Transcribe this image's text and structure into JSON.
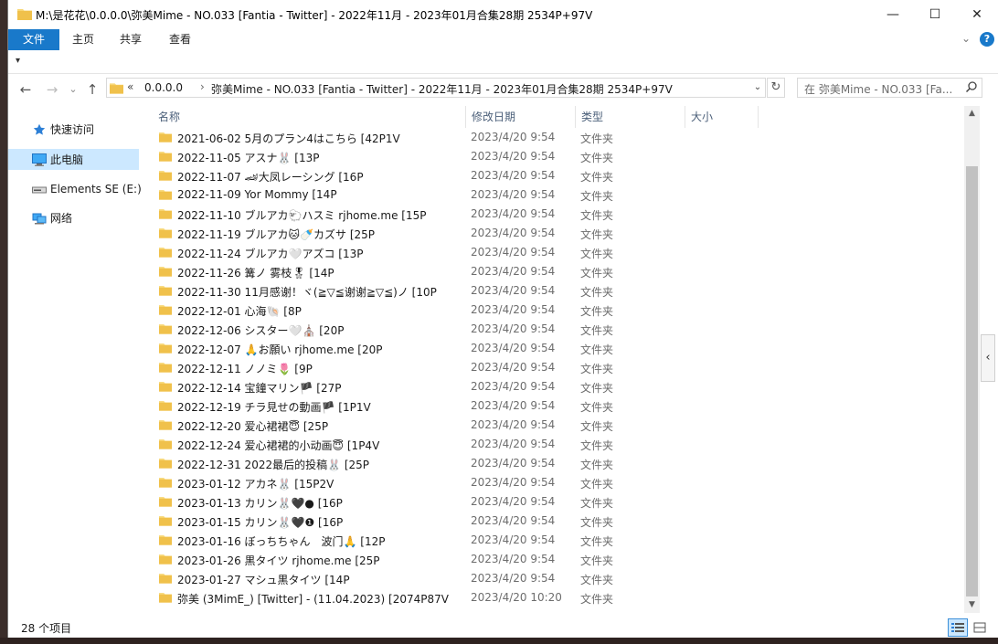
{
  "window": {
    "title": "M:\\是花花\\0.0.0.0\\弥美Mime - NO.033 [Fantia - Twitter] - 2022年11月 - 2023年01月合集28期 2534P+97V",
    "min_glyph": "—",
    "max_glyph": "☐",
    "close_glyph": "✕"
  },
  "ribbon": {
    "tabs": [
      "文件",
      "主页",
      "共享",
      "查看"
    ],
    "active_tab": 0,
    "expand_glyph": "⌄",
    "help_glyph": "?"
  },
  "nav": {
    "back": "←",
    "forward": "→",
    "recent": "⌄",
    "up": "↑",
    "refresh": "↻",
    "chevron": "«",
    "breadcrumb": [
      "0.0.0.0",
      "弥美Mime - NO.033 [Fantia - Twitter] - 2022年11月 - 2023年01月合集28期 2534P+97V"
    ],
    "separator": "›",
    "dropdown": "⌄",
    "search_placeholder": "在 弥美Mime - NO.033 [Fa..."
  },
  "navpane": {
    "items": [
      {
        "label": "快速访问",
        "icon": "star-icon"
      },
      {
        "label": "此电脑",
        "icon": "computer-icon",
        "selected": true
      },
      {
        "label": "Elements SE (E:)",
        "icon": "drive-icon"
      },
      {
        "label": "网络",
        "icon": "network-icon"
      }
    ]
  },
  "columns": [
    "名称",
    "修改日期",
    "类型",
    "大小"
  ],
  "sort_glyph": "^",
  "files": [
    {
      "name": "2021-06-02 5月のプラン4はこちら [42P1V",
      "date": "2023/4/20 9:54",
      "type": "文件夹"
    },
    {
      "name": "2022-11-05 アスナ🐰 [13P",
      "date": "2023/4/20 9:54",
      "type": "文件夹"
    },
    {
      "name": "2022-11-07 🏎大凤レーシング [16P",
      "date": "2023/4/20 9:54",
      "type": "文件夹"
    },
    {
      "name": "2022-11-09 Yor Mommy [14P",
      "date": "2023/4/20 9:54",
      "type": "文件夹"
    },
    {
      "name": "2022-11-10 ブルアカ🐑ハスミ rjhome.me [15P",
      "date": "2023/4/20 9:54",
      "type": "文件夹"
    },
    {
      "name": "2022-11-19 ブルアカ🐱🍼カズサ [25P",
      "date": "2023/4/20 9:54",
      "type": "文件夹"
    },
    {
      "name": "2022-11-24 ブルアカ🤍アズコ [13P",
      "date": "2023/4/20 9:54",
      "type": "文件夹"
    },
    {
      "name": "2022-11-26 篝ノ 雾枝🎖 [14P",
      "date": "2023/4/20 9:54",
      "type": "文件夹"
    },
    {
      "name": "2022-11-30 11月感谢！ヾ(≧▽≦谢谢≧▽≦)ノ [10P",
      "date": "2023/4/20 9:54",
      "type": "文件夹"
    },
    {
      "name": "2022-12-01 心海🐚 [8P",
      "date": "2023/4/20 9:54",
      "type": "文件夹"
    },
    {
      "name": "2022-12-06 シスター🤍⛪ [20P",
      "date": "2023/4/20 9:54",
      "type": "文件夹"
    },
    {
      "name": "2022-12-07 🙏お願い rjhome.me [20P",
      "date": "2023/4/20 9:54",
      "type": "文件夹"
    },
    {
      "name": "2022-12-11 ノノミ🌷 [9P",
      "date": "2023/4/20 9:54",
      "type": "文件夹"
    },
    {
      "name": "2022-12-14 宝鐘マリン🏴 [27P",
      "date": "2023/4/20 9:54",
      "type": "文件夹"
    },
    {
      "name": "2022-12-19 チラ見せの動画🏴 [1P1V",
      "date": "2023/4/20 9:54",
      "type": "文件夹"
    },
    {
      "name": "2022-12-20 爱心裙裙😇 [25P",
      "date": "2023/4/20 9:54",
      "type": "文件夹"
    },
    {
      "name": "2022-12-24 爱心裙裙的小动画😇 [1P4V",
      "date": "2023/4/20 9:54",
      "type": "文件夹"
    },
    {
      "name": "2022-12-31 2022最后的投稿🐰 [25P",
      "date": "2023/4/20 9:54",
      "type": "文件夹"
    },
    {
      "name": "2023-01-12 アカネ🐰 [15P2V",
      "date": "2023/4/20 9:54",
      "type": "文件夹"
    },
    {
      "name": "2023-01-13 カリン🐰🖤● [16P",
      "date": "2023/4/20 9:54",
      "type": "文件夹"
    },
    {
      "name": "2023-01-15 カリン🐰🖤❶ [16P",
      "date": "2023/4/20 9:54",
      "type": "文件夹"
    },
    {
      "name": "2023-01-16 ぼっちちゃん　波门🙏 [12P",
      "date": "2023/4/20 9:54",
      "type": "文件夹"
    },
    {
      "name": "2023-01-26 黒タイツ rjhome.me [25P",
      "date": "2023/4/20 9:54",
      "type": "文件夹"
    },
    {
      "name": "2023-01-27 マシュ黒タイツ [14P",
      "date": "2023/4/20 9:54",
      "type": "文件夹"
    },
    {
      "name": "弥美 (3MimE_) [Twitter] - (11.04.2023) [2074P87V",
      "date": "2023/4/20 10:20",
      "type": "文件夹"
    }
  ],
  "scroll": {
    "up": "▲",
    "down": "▼",
    "side_handle": "‹"
  },
  "status": {
    "item_count": "28 个项目"
  },
  "colors": {
    "accent": "#1979ca",
    "selection": "#cce8ff",
    "folder": "#f8d775"
  }
}
